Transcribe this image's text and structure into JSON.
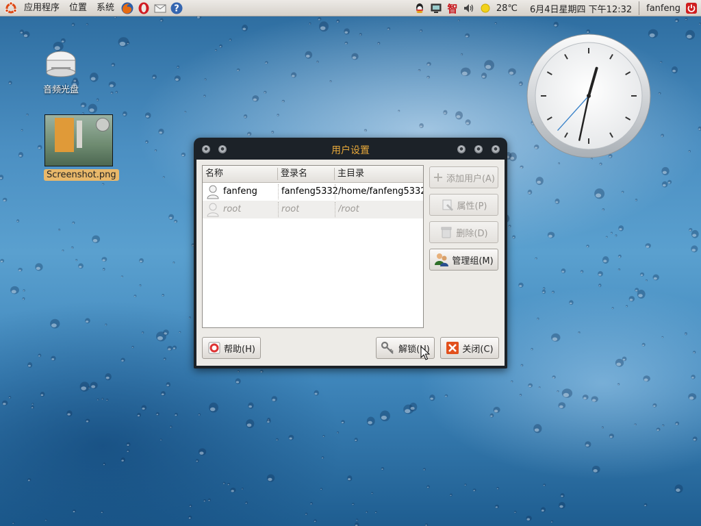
{
  "panel": {
    "menus": [
      "应用程序",
      "位置",
      "系统"
    ],
    "weather": "28℃",
    "datetime": "6月4日星期四 下午12:32",
    "user": "fanfeng",
    "launcher_icons": [
      "firefox-icon",
      "opera-icon",
      "mail-icon",
      "help-icon"
    ],
    "tray_icons": [
      "qq-icon",
      "display-icon",
      "input-method-icon",
      "volume-icon",
      "weather-sun-icon"
    ]
  },
  "desktop": {
    "icons": [
      {
        "label": "音频光盘",
        "icon": "cd-drive-icon"
      },
      {
        "label": "Screenshot.png",
        "icon": "image-thumbnail"
      }
    ]
  },
  "clock": {
    "hour": 12,
    "minute": 32
  },
  "dialog": {
    "title": "用户设置",
    "columns": [
      "名称",
      "登录名",
      "主目录"
    ],
    "rows": [
      {
        "name": "fanfeng",
        "login": "fanfeng5332",
        "home": "/home/fanfeng5332",
        "enabled": true
      },
      {
        "name": "root",
        "login": "root",
        "home": "/root",
        "enabled": false
      }
    ],
    "buttons": {
      "add_user": "添加用户(A)",
      "properties": "属性(P)",
      "delete": "删除(D)",
      "manage_groups": "管理组(M)",
      "help": "帮助(H)",
      "unlock": "解锁(U)",
      "close": "关闭(C)"
    }
  },
  "colors": {
    "title_text": "#e8a93a",
    "panel_bg": "#e4e0db",
    "window_frame": "#1c2228"
  }
}
